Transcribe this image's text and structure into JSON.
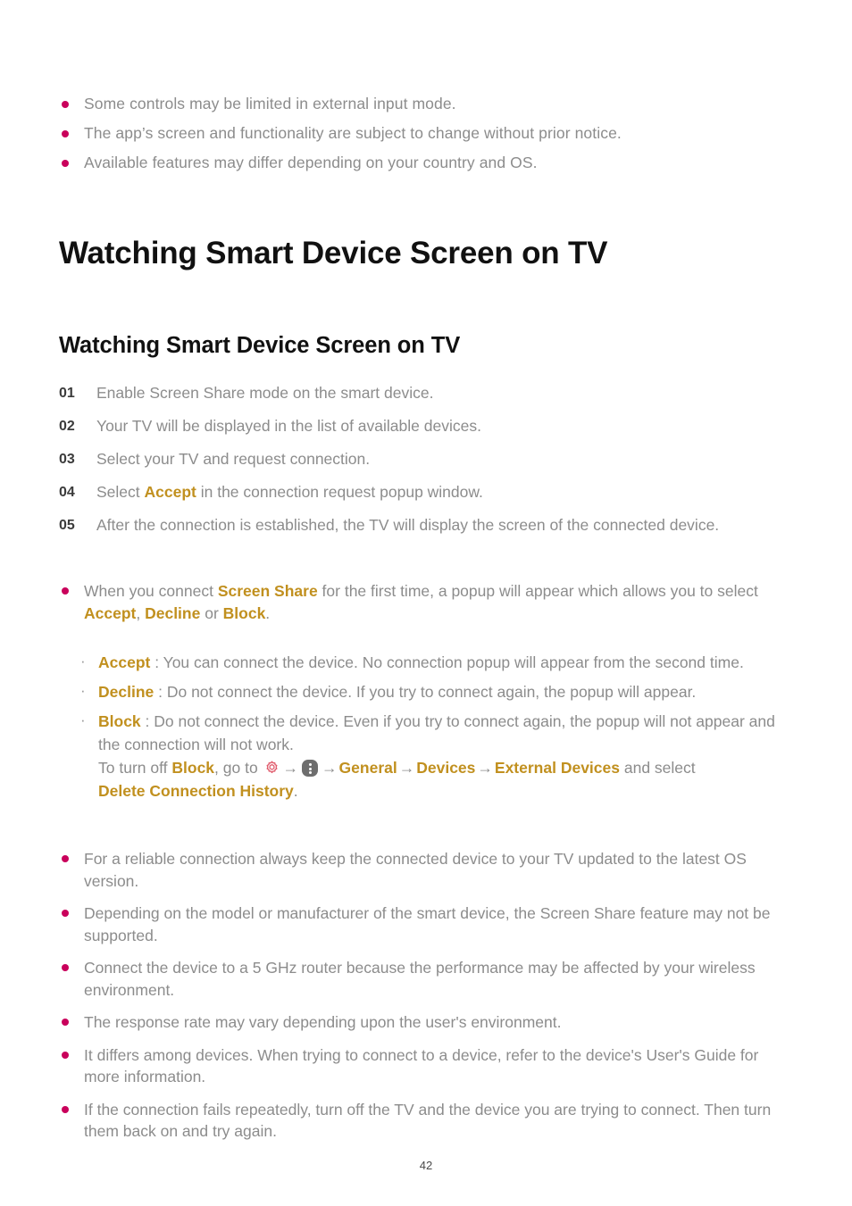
{
  "document": {
    "page_number": "42",
    "colors": {
      "bullet": "#c9005b",
      "accent": "#c1901f",
      "body_text": "#8c8c8c",
      "heading": "#111111",
      "gear_icon": "#e05a6b",
      "dots_icon": "#6e6e6e"
    }
  },
  "top_notes": [
    "Some controls may be limited in external input mode.",
    "The app’s screen and functionality are subject to change without prior notice.",
    "Available features may differ depending on your country and OS."
  ],
  "headings": {
    "h1": "Watching Smart Device Screen on TV",
    "h2": "Watching Smart Device Screen on TV"
  },
  "steps": [
    {
      "num": "01",
      "text": "Enable Screen Share mode on the smart device."
    },
    {
      "num": "02",
      "text": "Your TV will be displayed in the list of available devices."
    },
    {
      "num": "03",
      "text": "Select your TV and request connection."
    },
    {
      "num": "04",
      "text_before": "Select ",
      "accent": "Accept",
      "text_after": " in the connection request popup window."
    },
    {
      "num": "05",
      "text": "After the connection is established, the TV will display the screen of the connected device."
    }
  ],
  "intro_bullet": {
    "part1": "When you connect ",
    "accent1": "Screen Share",
    "part2": " for the first time, a popup will appear which allows you to select ",
    "accent2": "Accept",
    "part3": ", ",
    "accent3": "Decline",
    "part4": " or ",
    "accent4": "Block",
    "part5": "."
  },
  "sub_bullets": {
    "accept": {
      "marker": "·",
      "term": "Accept",
      "text": " : You can connect the device. No connection popup will appear from the second time."
    },
    "decline": {
      "marker": "·",
      "term": "Decline",
      "text": " : Do not connect the device. If you try to connect again, the popup will appear."
    },
    "block": {
      "marker": "·",
      "term": "Block",
      "text": " : Do not connect the device. Even if you try to connect again, the popup will not appear and the connection will not work.",
      "path_prefix": "To turn off ",
      "path_term": "Block",
      "path_mid": ", go to ",
      "arrow": "→",
      "menu_general": "General",
      "menu_devices": "Devices",
      "menu_external": "External Devices",
      "path_suffix": " and select ",
      "path_target": "Delete Connection History",
      "path_end": "."
    },
    "icons": {
      "settings": "gear-icon",
      "more": "three-dots-icon"
    }
  },
  "notes": [
    "For a reliable connection always keep the connected device to your TV updated to the latest OS version.",
    "Depending on the model or manufacturer of the smart device, the Screen Share feature may not be supported.",
    "Connect the device to a 5 GHz router because the performance may be affected by your wireless environment.",
    "The response rate may vary depending upon the user's environment.",
    "It differs among devices. When trying to connect to a device, refer to the device's User's Guide for more information.",
    "If the connection fails repeatedly, turn off the TV and the device you are trying to connect. Then turn them back on and try again."
  ]
}
